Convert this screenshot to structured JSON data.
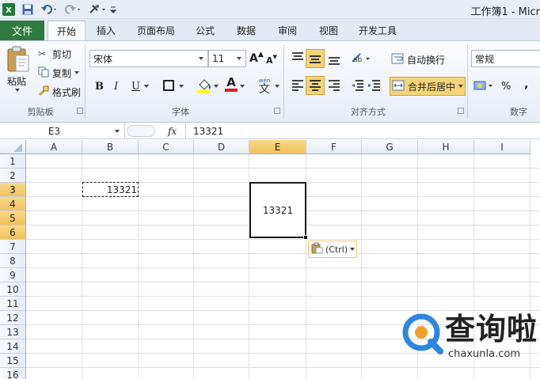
{
  "app_title": "工作簿1 - Micr",
  "tabs": {
    "file": "文件",
    "home": "开始",
    "insert": "插入",
    "page_layout": "页面布局",
    "formulas": "公式",
    "data": "数据",
    "review": "审阅",
    "view": "视图",
    "developer": "开发工具"
  },
  "clipboard": {
    "paste": "粘贴",
    "cut": "剪切",
    "copy": "复制",
    "format_painter": "格式刷",
    "group": "剪贴板"
  },
  "font": {
    "name": "宋体",
    "size": "11",
    "bold": "B",
    "italic": "I",
    "underline": "U",
    "grow": "A",
    "shrink": "A",
    "font_color_glyph": "A",
    "wen": "wén",
    "wen_char": "文",
    "group": "字体"
  },
  "alignment": {
    "wrap": "自动换行",
    "merge": "合并后居中",
    "group": "对齐方式"
  },
  "number": {
    "format": "常规",
    "percent": "%",
    "comma": ",",
    "group": "数字"
  },
  "formula_bar": {
    "name_box": "E3",
    "fx": "fx",
    "value": "13321"
  },
  "columns": [
    "A",
    "B",
    "C",
    "D",
    "E",
    "F",
    "G",
    "H",
    "I"
  ],
  "rows": [
    "1",
    "2",
    "3",
    "4",
    "5",
    "6",
    "7",
    "8",
    "9",
    "10",
    "11",
    "12",
    "13",
    "14",
    "15",
    "16"
  ],
  "cells": {
    "B3": "13321",
    "E3": "13321"
  },
  "paste_options": {
    "label": "(Ctrl)"
  },
  "watermark": {
    "brand": "查询啦",
    "url": "chaxunla.com"
  },
  "colors": {
    "file_tab": "#2f7b3f",
    "selection_header": "#f1c15f",
    "highlight_button": "#f6d478"
  }
}
